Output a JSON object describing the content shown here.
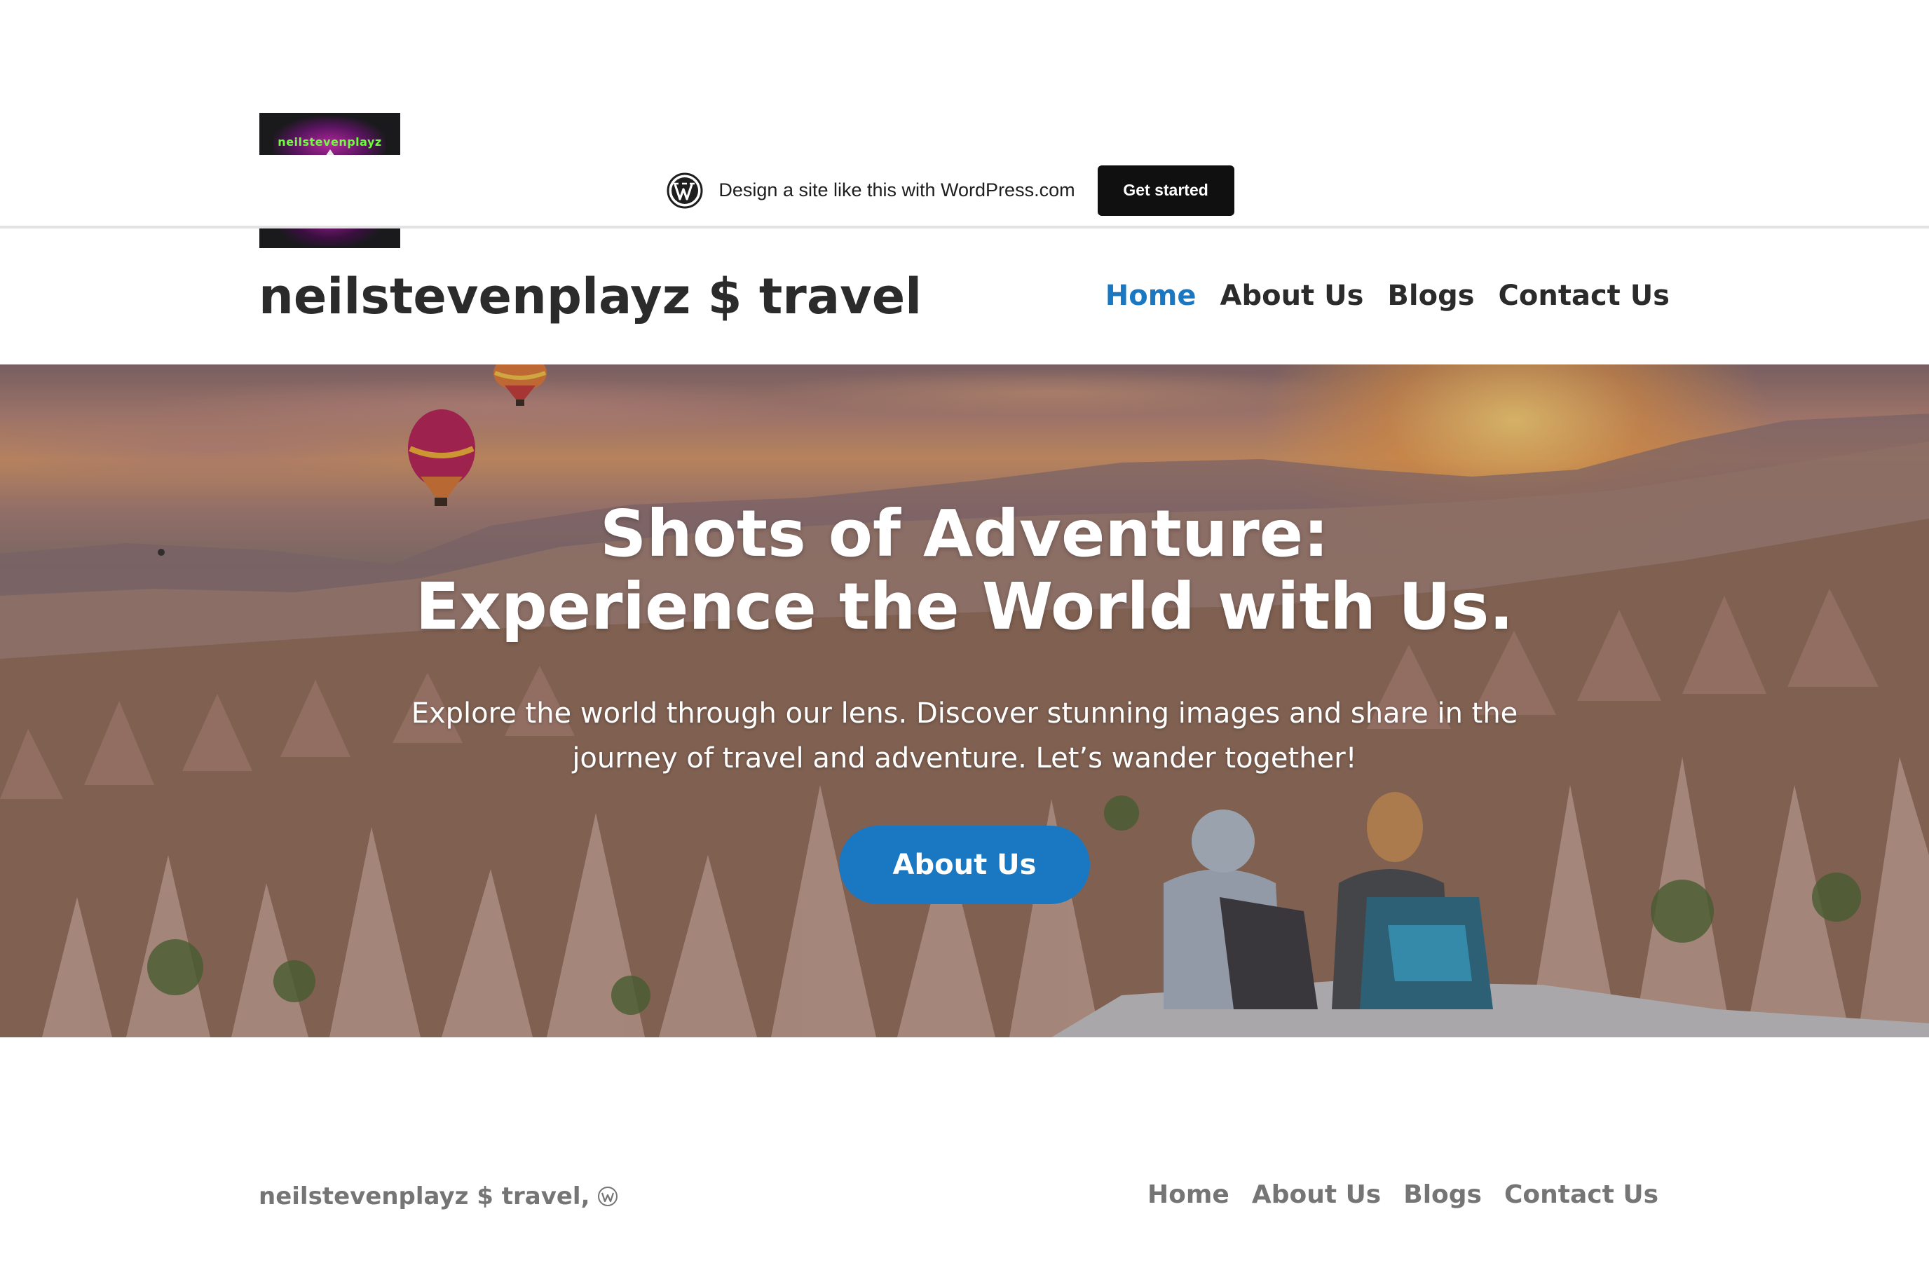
{
  "logo": {
    "text": "neilstevenplayz"
  },
  "wp_banner": {
    "icon": "wordpress-logo-icon",
    "text": "Design a site like this with WordPress.com",
    "button_label": "Get started"
  },
  "header": {
    "site_title": "neilstevenplayz $ travel",
    "nav": [
      {
        "label": "Home",
        "active": true
      },
      {
        "label": "About Us",
        "active": false
      },
      {
        "label": "Blogs",
        "active": false
      },
      {
        "label": "Contact Us",
        "active": false
      }
    ]
  },
  "hero": {
    "title": "Shots of Adventure: Experience the World with Us.",
    "subtitle": "Explore the world through our lens. Discover stunning images and share in the journey of travel and adventure. Let’s wander together!",
    "button_label": "About Us"
  },
  "footer": {
    "site_name": "neilstevenplayz $ travel",
    "separator": ",",
    "wp_icon": "wordpress-small-icon",
    "nav": [
      "Home",
      "About Us",
      "Blogs",
      "Contact Us"
    ]
  },
  "colors": {
    "accent": "#1a78c2",
    "text_dark": "#2b2b2b",
    "footer_text": "#757575",
    "banner_button": "#101010"
  }
}
